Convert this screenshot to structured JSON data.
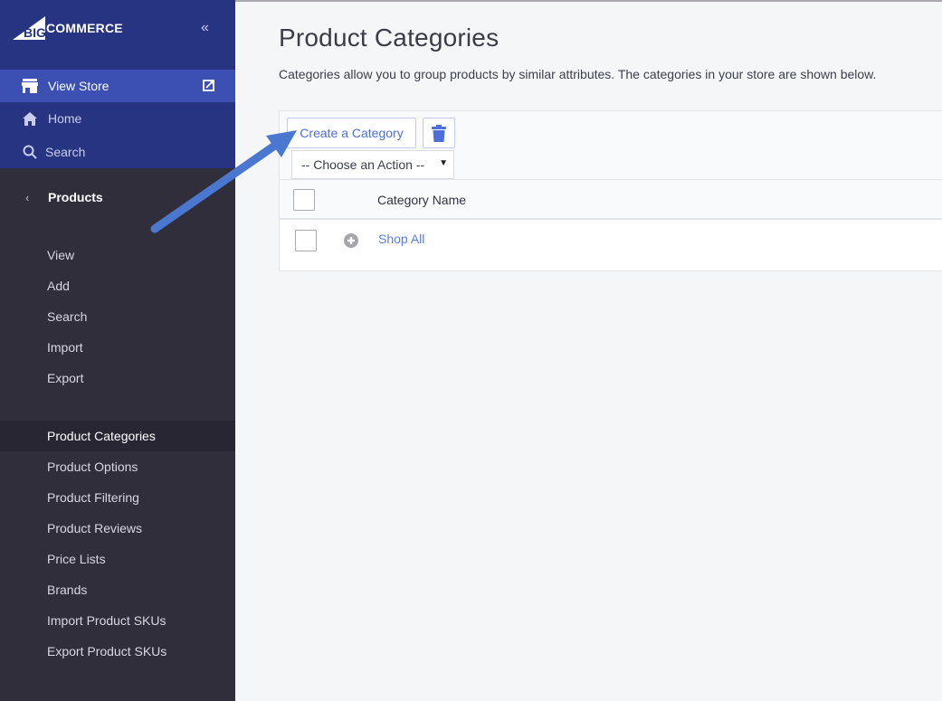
{
  "brand": {
    "logo_big": "BIG",
    "logo_text": "COMMERCE"
  },
  "sidebar": {
    "collapse_icon": "double-chevron-left",
    "top_items": [
      {
        "label": "View Store",
        "icon": "store-icon",
        "trailing_icon": "external-link-icon"
      },
      {
        "label": "Home",
        "icon": "home-icon"
      },
      {
        "label": "Search",
        "icon": "search-icon"
      }
    ],
    "section": {
      "label": "Products",
      "back_icon": "chevron-left"
    },
    "sub_items_group1": [
      {
        "label": "View"
      },
      {
        "label": "Add"
      },
      {
        "label": "Search"
      },
      {
        "label": "Import"
      },
      {
        "label": "Export"
      }
    ],
    "sub_items_group2": [
      {
        "label": "Product Categories",
        "active": true
      },
      {
        "label": "Product Options"
      },
      {
        "label": "Product Filtering"
      },
      {
        "label": "Product Reviews"
      },
      {
        "label": "Price Lists"
      },
      {
        "label": "Brands"
      },
      {
        "label": "Import Product SKUs"
      },
      {
        "label": "Export Product SKUs"
      }
    ]
  },
  "main": {
    "title": "Product Categories",
    "description": "Categories allow you to group products by similar attributes. The categories in your store are shown below.",
    "toolbar": {
      "create_label": "Create a Category",
      "delete_icon": "trash-icon",
      "action_select": {
        "selected": "-- Choose an Action --"
      }
    },
    "table": {
      "columns": [
        "",
        "",
        "Category Name"
      ],
      "rows": [
        {
          "name": "Shop All",
          "expand_icon": "plus-circle-icon"
        }
      ]
    }
  },
  "colors": {
    "sidebar_top": "#263482",
    "sidebar_active": "#3c4fb3",
    "sidebar_body": "#312e3c",
    "link": "#5a7fe0",
    "arrow": "#4a78d0"
  }
}
